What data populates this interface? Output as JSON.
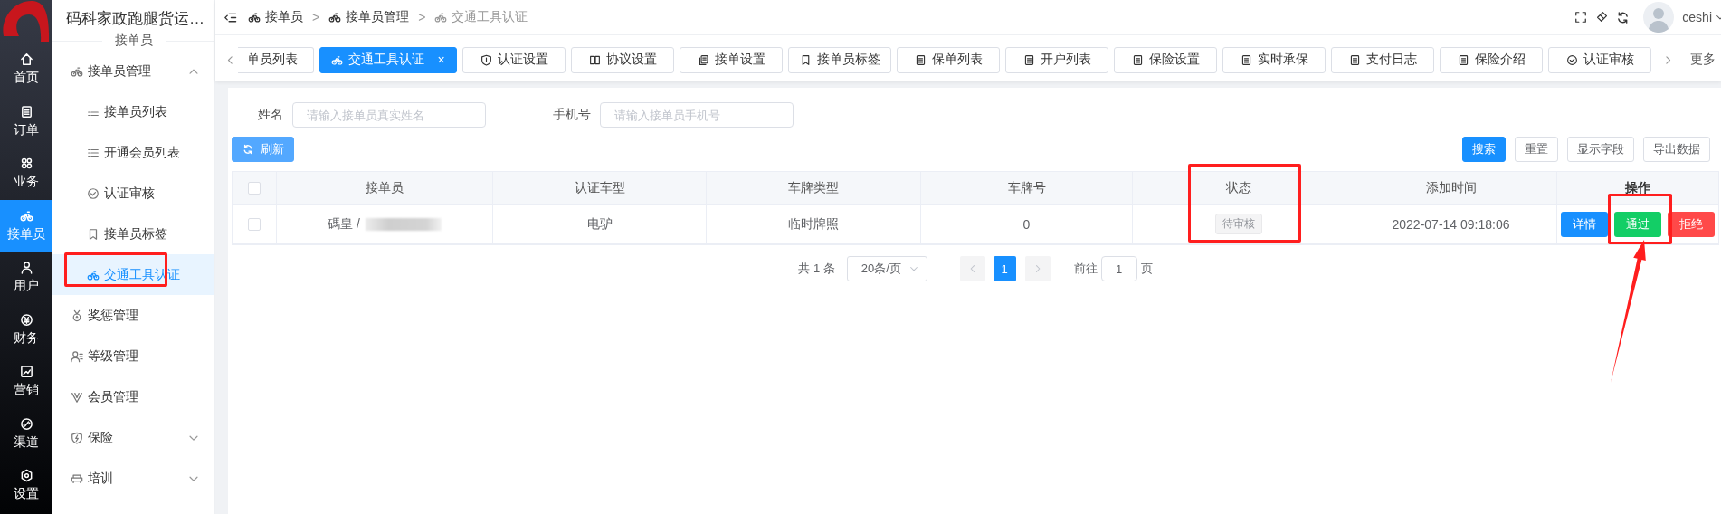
{
  "rail": {
    "items": [
      {
        "label": "首页",
        "selected": false
      },
      {
        "label": "订单",
        "selected": false
      },
      {
        "label": "业务",
        "selected": false
      },
      {
        "label": "接单员",
        "selected": true
      },
      {
        "label": "用户",
        "selected": false
      },
      {
        "label": "财务",
        "selected": false
      },
      {
        "label": "营销",
        "selected": false
      },
      {
        "label": "渠道",
        "selected": false
      },
      {
        "label": "设置",
        "selected": false
      }
    ]
  },
  "sidebar": {
    "title": "码科家政跑腿货运…",
    "subtitle": "接单员",
    "menu": [
      {
        "label": "接单员管理",
        "expanded": true,
        "selected": false,
        "children": [
          {
            "label": "接单员列表",
            "selected": false
          },
          {
            "label": "开通会员列表",
            "selected": false
          },
          {
            "label": "认证审核",
            "selected": false
          },
          {
            "label": "接单员标签",
            "selected": false
          },
          {
            "label": "交通工具认证",
            "selected": true
          }
        ]
      },
      {
        "label": "奖惩管理",
        "selected": false
      },
      {
        "label": "等级管理",
        "selected": false
      },
      {
        "label": "会员管理",
        "selected": false
      },
      {
        "label": "保险",
        "expanded": false,
        "selected": false
      },
      {
        "label": "培训",
        "expanded": false,
        "selected": false
      }
    ]
  },
  "header": {
    "breadcrumb": [
      {
        "kind": "link",
        "label": "接单员",
        "current": false
      },
      {
        "kind": "separator",
        "label": ">"
      },
      {
        "kind": "link",
        "label": "接单员管理",
        "current": false
      },
      {
        "kind": "separator",
        "label": ">"
      },
      {
        "kind": "link",
        "label": "交通工具认证",
        "current": true
      }
    ],
    "user": {
      "name": "ceshi"
    }
  },
  "tabs": {
    "items": [
      {
        "label": "单员列表",
        "selected": false
      },
      {
        "label": "交通工具认证",
        "selected": true,
        "close": "×"
      },
      {
        "label": "认证设置",
        "selected": false
      },
      {
        "label": "协议设置",
        "selected": false
      },
      {
        "label": "接单设置",
        "selected": false
      },
      {
        "label": "接单员标签",
        "selected": false
      },
      {
        "label": "保单列表",
        "selected": false
      },
      {
        "label": "开户列表",
        "selected": false
      },
      {
        "label": "保险设置",
        "selected": false
      },
      {
        "label": "实时承保",
        "selected": false
      },
      {
        "label": "支付日志",
        "selected": false
      },
      {
        "label": "保险介绍",
        "selected": false
      },
      {
        "label": "认证审核",
        "selected": false
      }
    ],
    "more": "更多"
  },
  "filters": [
    {
      "label": "姓名",
      "placeholder": "请输入接单员真实姓名"
    },
    {
      "label": "手机号",
      "placeholder": "请输入接单员手机号"
    }
  ],
  "toolbar": {
    "refresh": "刷新",
    "buttons": [
      {
        "label": "搜索",
        "kind": "primary"
      },
      {
        "label": "重置",
        "kind": "default"
      },
      {
        "label": "显示字段",
        "kind": "default"
      },
      {
        "label": "导出数据",
        "kind": "default"
      }
    ]
  },
  "table": {
    "select_all_checked": false,
    "columns": [
      "接单员",
      "认证车型",
      "车牌类型",
      "车牌号",
      "状态",
      "添加时间",
      "操作"
    ],
    "rows": [
      {
        "checked": false,
        "cells": [
          {
            "kind": "masked",
            "text": "碼皇 /"
          },
          {
            "kind": "text",
            "text": "电驴"
          },
          {
            "kind": "text",
            "text": "临时牌照"
          },
          {
            "kind": "text",
            "text": "0"
          },
          {
            "kind": "tag",
            "text": "待审核"
          },
          {
            "kind": "text",
            "text": "2022-07-14 09:18:06"
          }
        ],
        "actions": [
          {
            "label": "详情",
            "kind": "primary"
          },
          {
            "label": "通过",
            "kind": "success"
          },
          {
            "label": "拒绝",
            "kind": "danger"
          }
        ]
      }
    ]
  },
  "pagination": {
    "total": "共 1 条",
    "page_size": "20条/页",
    "pages": [
      {
        "label": "1",
        "selected": true
      }
    ],
    "goto_label": "前往",
    "goto_value": "1",
    "goto_suffix": "页"
  }
}
